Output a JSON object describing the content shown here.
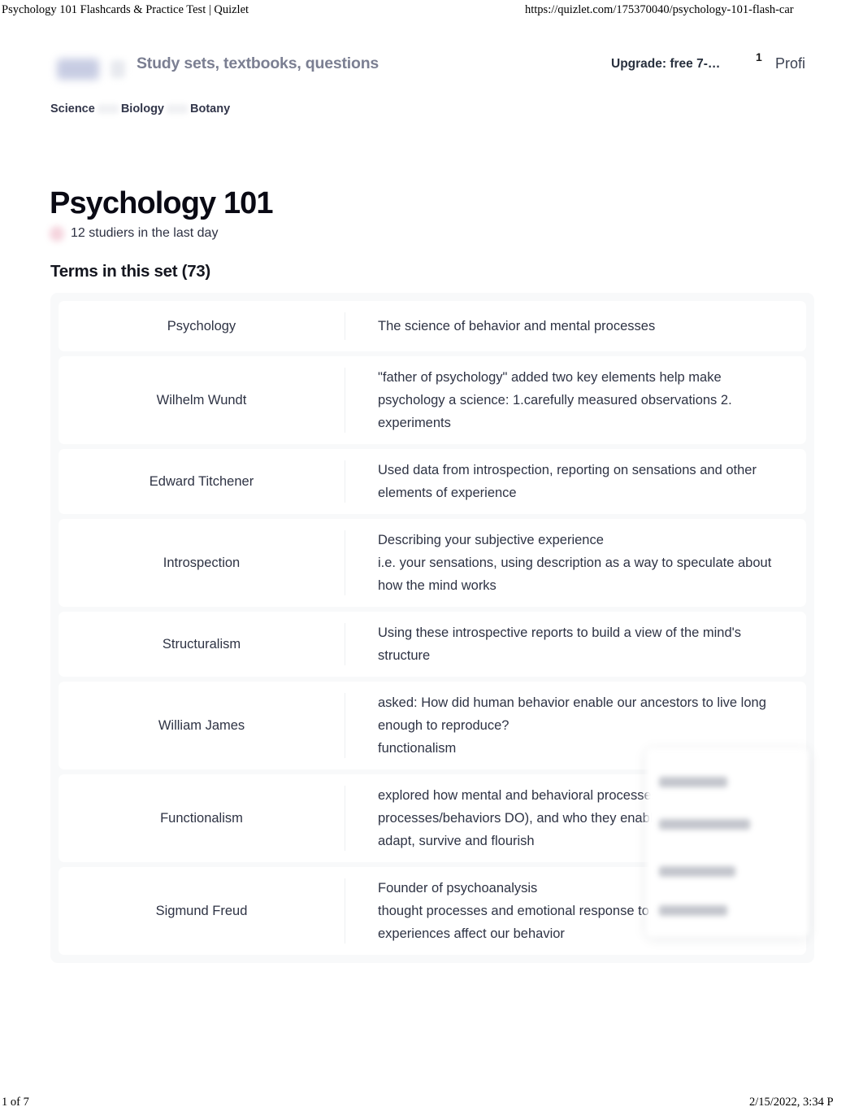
{
  "print": {
    "document_title": "Psychology 101 Flashcards & Practice Test | Quizlet",
    "url": "https://quizlet.com/175370040/psychology-101-flash-car",
    "page_indicator": "1 of 7",
    "timestamp": "2/15/2022, 3:34 P"
  },
  "header": {
    "search_placeholder": "Study sets, textbooks, questions",
    "upgrade_label": "Upgrade: free 7-…",
    "notification_count": "1",
    "profile_label": "Profi"
  },
  "breadcrumb": {
    "items": [
      {
        "label": "Science"
      },
      {
        "label": "Biology"
      },
      {
        "label": "Botany"
      }
    ]
  },
  "set": {
    "title": "Psychology 101",
    "studiers": "12 studiers in the last day",
    "terms_heading": "Terms in this set (73)"
  },
  "terms": [
    {
      "term": "Psychology",
      "definition": "The science of behavior and mental processes"
    },
    {
      "term": "Wilhelm Wundt",
      "definition": "\"father of psychology\" added two key elements help make psychology a science: 1.carefully measured observations 2. experiments"
    },
    {
      "term": "Edward Titchener",
      "definition": "Used data from introspection, reporting on sensations and other elements of experience"
    },
    {
      "term": "Introspection",
      "definition": "Describing your subjective experience\ni.e. your sensations, using description as a way to speculate about how the mind works"
    },
    {
      "term": "Structuralism",
      "definition": "Using these introspective reports to build a view of the mind's structure"
    },
    {
      "term": "William James",
      "definition": "asked: How did human behavior enable our ancestors to live long enough to reproduce?\nfunctionalism"
    },
    {
      "term": "Functionalism",
      "definition": "explored how mental and behavioral processes (i.e., what mental processes/behaviors DO), and who they enable the organism to adapt, survive and flourish"
    },
    {
      "term": "Sigmund Freud",
      "definition": "Founder of psychoanalysis\nthought processes and emotional response to childhood experiences affect our behavior"
    }
  ],
  "colors": {
    "page_background": "#ffffff",
    "card_background": "#f8f9fa",
    "row_background": "#ffffff",
    "text_primary": "#2e3344",
    "text_heading": "#0a0a14",
    "placeholder_text": "#7b7f92"
  }
}
